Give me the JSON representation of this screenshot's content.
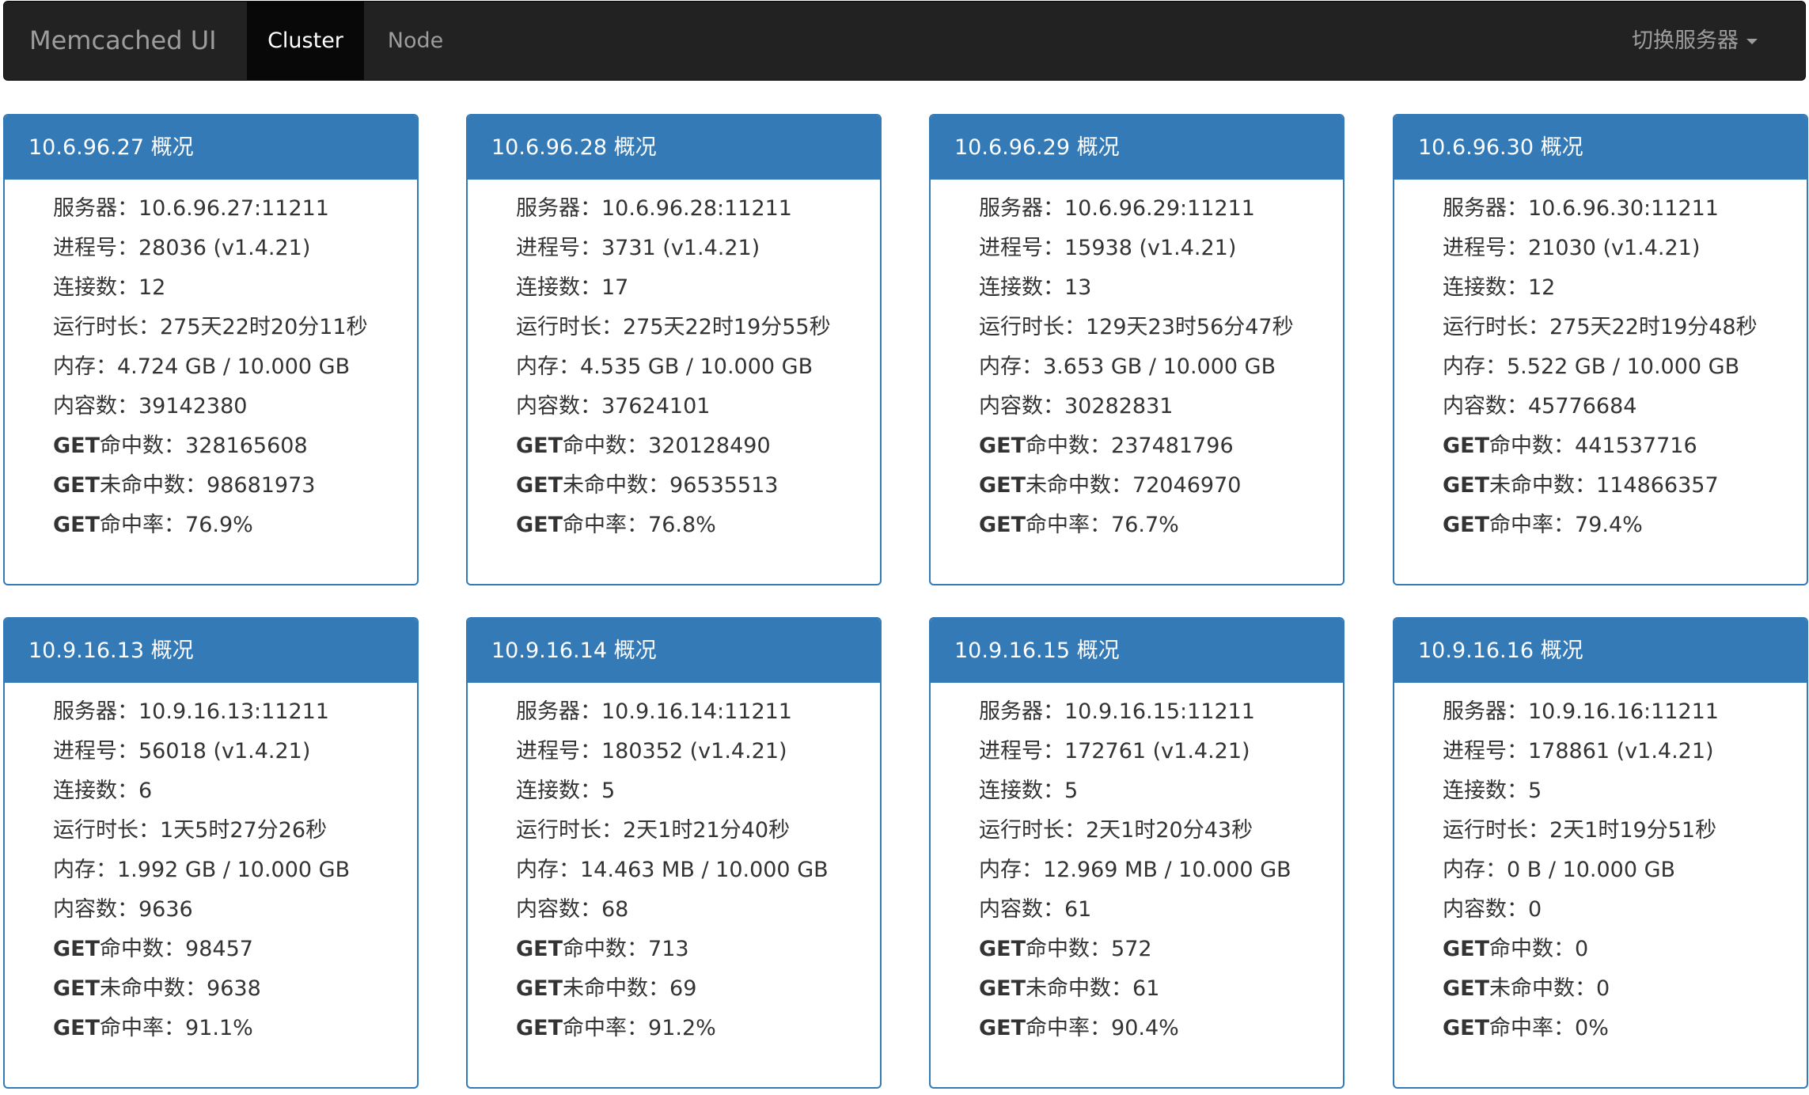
{
  "navbar": {
    "brand": "Memcached UI",
    "tabs": [
      {
        "label": "Cluster",
        "active": true
      },
      {
        "label": "Node",
        "active": false
      }
    ],
    "switch_label": "切换服务器"
  },
  "labels": {
    "server": "服务器：",
    "pid": "进程号：",
    "connections": "连接数：",
    "uptime": "运行时长：",
    "memory": "内存：",
    "items": "内容数：",
    "get_prefix": "GET",
    "get_hits": "命中数：",
    "get_misses": "未命中数：",
    "get_hit_rate": "命中率："
  },
  "panels": [
    {
      "title": "10.6.96.27 概况",
      "server": "10.6.96.27:11211",
      "pid": "28036 (v1.4.21)",
      "connections": "12",
      "uptime": "275天22时20分11秒",
      "memory": "4.724 GB / 10.000 GB",
      "items": "39142380",
      "get_hits": "328165608",
      "get_misses": "98681973",
      "get_hit_rate": "76.9%"
    },
    {
      "title": "10.6.96.28 概况",
      "server": "10.6.96.28:11211",
      "pid": "3731 (v1.4.21)",
      "connections": "17",
      "uptime": "275天22时19分55秒",
      "memory": "4.535 GB / 10.000 GB",
      "items": "37624101",
      "get_hits": "320128490",
      "get_misses": "96535513",
      "get_hit_rate": "76.8%"
    },
    {
      "title": "10.6.96.29 概况",
      "server": "10.6.96.29:11211",
      "pid": "15938 (v1.4.21)",
      "connections": "13",
      "uptime": "129天23时56分47秒",
      "memory": "3.653 GB / 10.000 GB",
      "items": "30282831",
      "get_hits": "237481796",
      "get_misses": "72046970",
      "get_hit_rate": "76.7%"
    },
    {
      "title": "10.6.96.30 概况",
      "server": "10.6.96.30:11211",
      "pid": "21030 (v1.4.21)",
      "connections": "12",
      "uptime": "275天22时19分48秒",
      "memory": "5.522 GB / 10.000 GB",
      "items": "45776684",
      "get_hits": "441537716",
      "get_misses": "114866357",
      "get_hit_rate": "79.4%"
    },
    {
      "title": "10.9.16.13 概况",
      "server": "10.9.16.13:11211",
      "pid": "56018 (v1.4.21)",
      "connections": "6",
      "uptime": "1天5时27分26秒",
      "memory": "1.992 GB / 10.000 GB",
      "items": "9636",
      "get_hits": "98457",
      "get_misses": "9638",
      "get_hit_rate": "91.1%"
    },
    {
      "title": "10.9.16.14 概况",
      "server": "10.9.16.14:11211",
      "pid": "180352 (v1.4.21)",
      "connections": "5",
      "uptime": "2天1时21分40秒",
      "memory": "14.463 MB / 10.000 GB",
      "items": "68",
      "get_hits": "713",
      "get_misses": "69",
      "get_hit_rate": "91.2%"
    },
    {
      "title": "10.9.16.15 概况",
      "server": "10.9.16.15:11211",
      "pid": "172761 (v1.4.21)",
      "connections": "5",
      "uptime": "2天1时20分43秒",
      "memory": "12.969 MB / 10.000 GB",
      "items": "61",
      "get_hits": "572",
      "get_misses": "61",
      "get_hit_rate": "90.4%"
    },
    {
      "title": "10.9.16.16 概况",
      "server": "10.9.16.16:11211",
      "pid": "178861 (v1.4.21)",
      "connections": "5",
      "uptime": "2天1时19分51秒",
      "memory": "0 B / 10.000 GB",
      "items": "0",
      "get_hits": "0",
      "get_misses": "0",
      "get_hit_rate": "0%"
    }
  ]
}
